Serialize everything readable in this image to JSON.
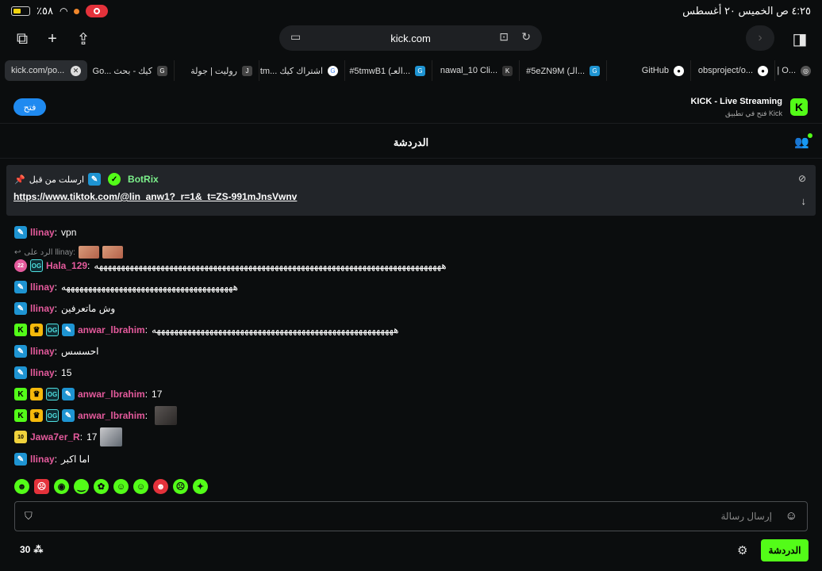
{
  "status_bar": {
    "time_date": "٤:٢٥ ص  الخميس ٢٠ أغسطس",
    "battery": "٪٥٨"
  },
  "browser": {
    "url": "kick.com",
    "tabs": [
      {
        "label": "kick.com/po...",
        "favicon": "kick-icon",
        "color": "#53fc18",
        "active": true
      },
      {
        "label": "Go... كيك - بحث",
        "favicon": "G",
        "color": "#444"
      },
      {
        "label": "رولیت | جولة",
        "favicon": "J",
        "color": "#444"
      },
      {
        "label": "tm... اشتراك كيك",
        "favicon": "google-icon",
        "color": "#4285f4"
      },
      {
        "label": "#5tmwB1 (العـ...",
        "favicon": "G",
        "color": "#1e94d2"
      },
      {
        "label": "nawal_10 Cli...",
        "favicon": "K",
        "color": "#444"
      },
      {
        "label": "#5eZN9M (الـ...",
        "favicon": "G",
        "color": "#1e94d2"
      },
      {
        "label": "GitHub",
        "favicon": "github-icon",
        "color": "#444"
      },
      {
        "label": "obsproject/o...",
        "favicon": "github-icon",
        "color": "#444"
      },
      {
        "label": "| O...",
        "favicon": "globe-icon",
        "color": "#444"
      }
    ]
  },
  "app_banner": {
    "open_label": "فتح",
    "title": "KICK - Live Streaming",
    "subtitle": "فتح في تطبيق Kick",
    "logo": "K"
  },
  "chat": {
    "title": "الدردشة",
    "pinned": {
      "label": "ارسلت من قبل",
      "author": "BotRix",
      "link": "https://www.tiktok.com/@lin_anw1?_r=1&_t=ZS-991mJnsVwnv"
    },
    "messages": [
      {
        "badges": [
          "mod"
        ],
        "user": "llinay",
        "color": "#e45a9c",
        "text": "vpn"
      },
      {
        "reply_to": "الرد على llinay:",
        "badges": [
          "sub",
          "og"
        ],
        "user": "Hala_129",
        "color": "#e45a9c",
        "text": "هههههههههههههههههههههههههههههههههههههههههههههههههههههههههههههههههههههههههههههههه"
      },
      {
        "badges": [
          "mod"
        ],
        "user": "llinay",
        "color": "#e45a9c",
        "text": "هههههههههههههههههههههههههههههههههههههههه"
      },
      {
        "badges": [
          "mod"
        ],
        "user": "llinay",
        "color": "#e45a9c",
        "text": "وش ماتعرفين"
      },
      {
        "badges": [
          "k",
          "crown",
          "og",
          "mod"
        ],
        "user": "anwar_lbrahim",
        "color": "#e45a9c",
        "text": "هههههههههههههههههههههههههههههههههههههههههههههههههههههههه"
      },
      {
        "badges": [
          "mod"
        ],
        "user": "llinay",
        "color": "#e45a9c",
        "text": "احسسس"
      },
      {
        "badges": [
          "mod"
        ],
        "user": "llinay",
        "color": "#e45a9c",
        "text": "15"
      },
      {
        "badges": [
          "k",
          "crown",
          "og",
          "mod"
        ],
        "user": "anwar_lbrahim",
        "color": "#e45a9c",
        "text": "17"
      },
      {
        "badges": [
          "k",
          "crown",
          "og",
          "mod"
        ],
        "user": "anwar_lbrahim",
        "color": "#e45a9c",
        "text": ""
      },
      {
        "badges": [
          "gift"
        ],
        "user": "Jawa7er_R",
        "color": "#e45a9c",
        "text": "17"
      },
      {
        "badges": [
          "mod"
        ],
        "user": "llinay",
        "color": "#e45a9c",
        "text": "اما اكبر"
      }
    ],
    "input_placeholder": "إرسال رسالة",
    "viewers": "30",
    "chat_button": "الدردشة"
  }
}
